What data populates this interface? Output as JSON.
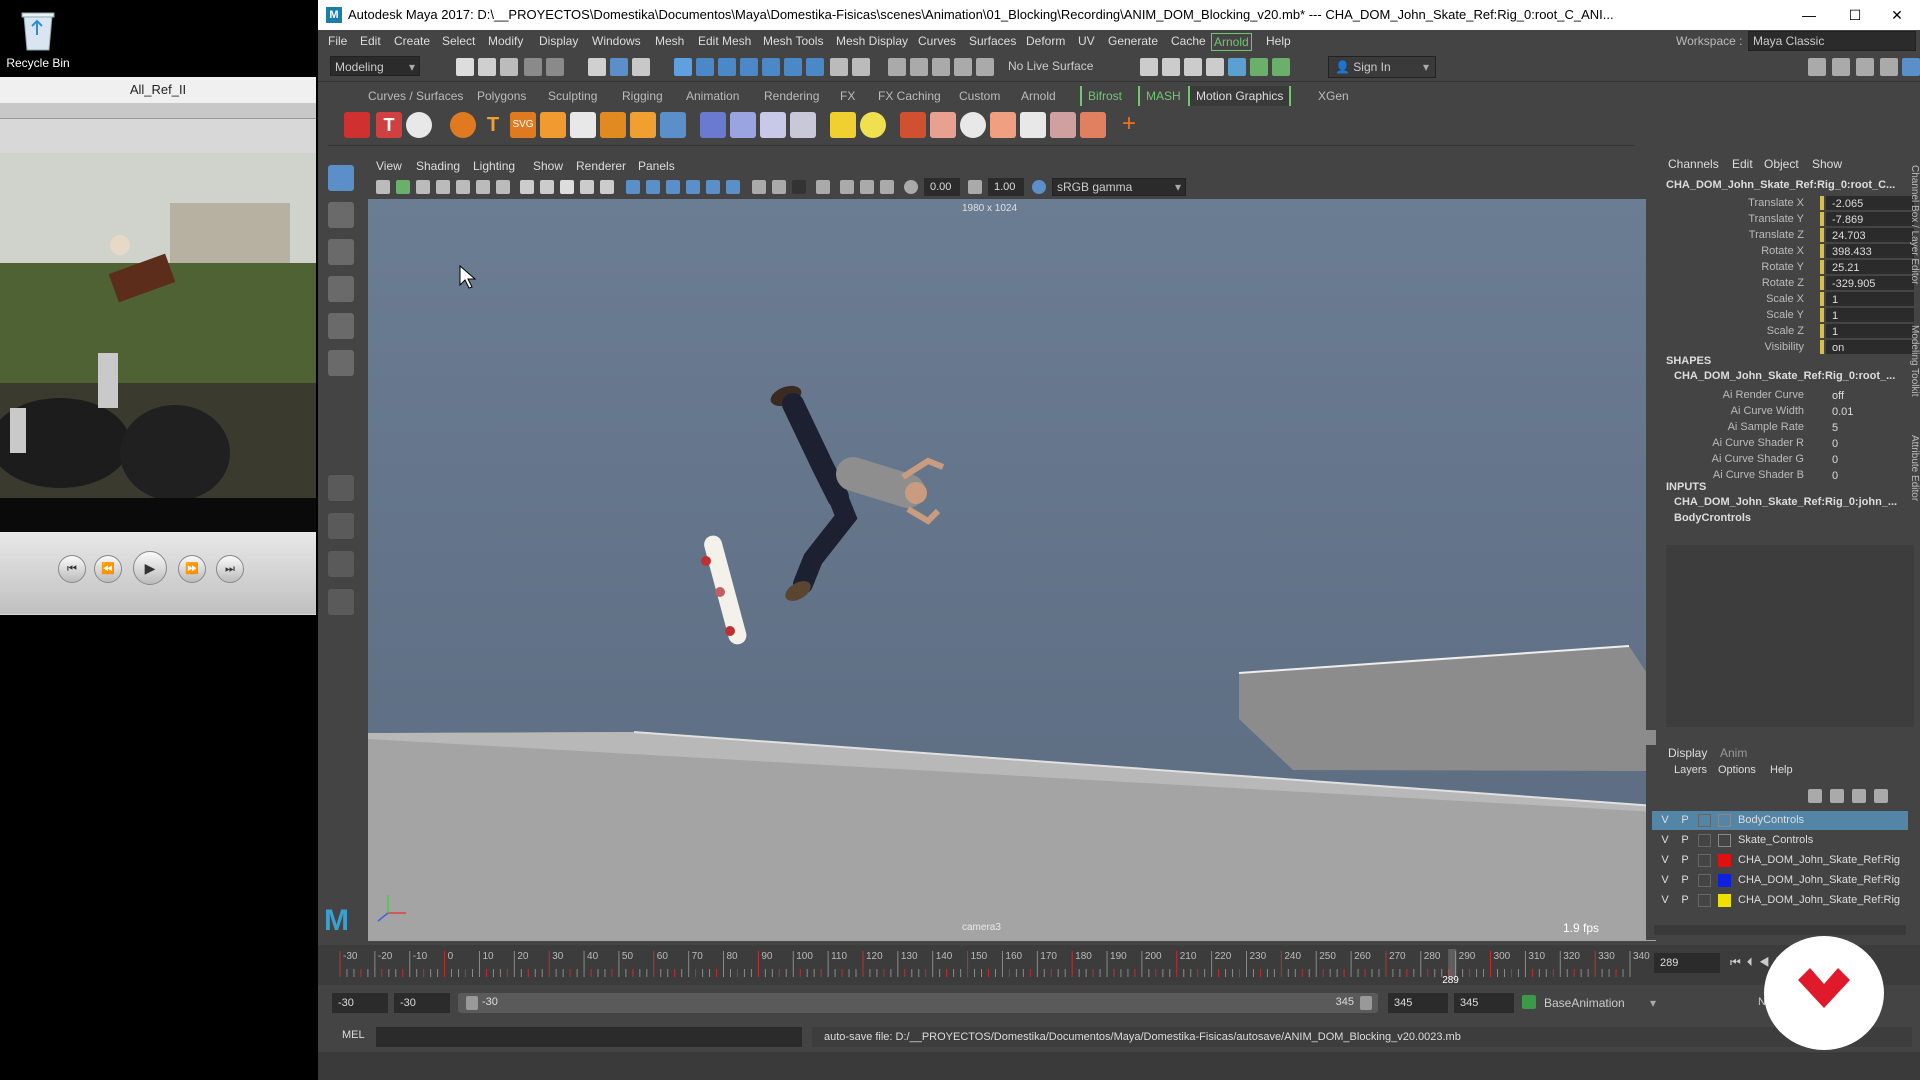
{
  "desktop": {
    "recycle_bin_label": "Recycle Bin",
    "player_title": "All_Ref_II"
  },
  "window": {
    "title": "Autodesk Maya 2017: D:\\__PROYECTOS\\Domestika\\Documentos\\Maya\\Domestika-Fisicas\\scenes\\Animation\\01_Blocking\\Recording\\ANIM_DOM_Blocking_v20.mb*   ---   CHA_DOM_John_Skate_Ref:Rig_0:root_C_ANI...",
    "logo": "M"
  },
  "menubar": {
    "items": [
      "File",
      "Edit",
      "Create",
      "Select",
      "Modify",
      "Display",
      "Windows",
      "Mesh",
      "Edit Mesh",
      "Mesh Tools",
      "Mesh Display",
      "Curves",
      "Surfaces",
      "Deform",
      "UV",
      "Generate",
      "Cache",
      "Arnold",
      "Help"
    ],
    "workspace_label": "Workspace :",
    "workspace_value": "Maya Classic"
  },
  "statusline": {
    "menuset": "Modeling",
    "live_surface": "No Live Surface",
    "sign_in": "Sign In"
  },
  "shelf_tabs": [
    "Curves / Surfaces",
    "Polygons",
    "Sculpting",
    "Rigging",
    "Animation",
    "Rendering",
    "FX",
    "FX Caching",
    "Custom",
    "Arnold",
    "Bifrost",
    "MASH",
    "Motion Graphics",
    "XGen"
  ],
  "viewport": {
    "menus": [
      "View",
      "Shading",
      "Lighting",
      "Show",
      "Renderer",
      "Panels"
    ],
    "field_a": "0.00",
    "field_b": "1.00",
    "color_space": "sRGB gamma",
    "resolution": "1980 x 1024",
    "camera": "camera3",
    "fps": "1.9 fps"
  },
  "channelbox": {
    "menus": [
      "Channels",
      "Edit",
      "Object",
      "Show"
    ],
    "node": "CHA_DOM_John_Skate_Ref:Rig_0:root_C...",
    "attrs": [
      {
        "label": "Translate X",
        "value": "-2.065"
      },
      {
        "label": "Translate Y",
        "value": "-7.869"
      },
      {
        "label": "Translate Z",
        "value": "24.703"
      },
      {
        "label": "Rotate X",
        "value": "398.433"
      },
      {
        "label": "Rotate Y",
        "value": "25.21"
      },
      {
        "label": "Rotate Z",
        "value": "-329.905"
      },
      {
        "label": "Scale X",
        "value": "1"
      },
      {
        "label": "Scale Y",
        "value": "1"
      },
      {
        "label": "Scale Z",
        "value": "1"
      },
      {
        "label": "Visibility",
        "value": "on"
      }
    ],
    "shapes_header": "SHAPES",
    "shape_node": "CHA_DOM_John_Skate_Ref:Rig_0:root_...",
    "shape_attrs": [
      {
        "label": "Ai Render Curve",
        "value": "off"
      },
      {
        "label": "Ai Curve Width",
        "value": "0.01"
      },
      {
        "label": "Ai Sample Rate",
        "value": "5"
      },
      {
        "label": "Ai Curve Shader R",
        "value": "0"
      },
      {
        "label": "Ai Curve Shader G",
        "value": "0"
      },
      {
        "label": "Ai Curve Shader B",
        "value": "0"
      }
    ],
    "inputs_header": "INPUTS",
    "input_nodes": [
      "CHA_DOM_John_Skate_Ref:Rig_0:john_...",
      "BodyCrontrols"
    ],
    "side_tabs": [
      "Channel Box / Layer Editor",
      "Modeling Toolkit",
      "Attribute Editor"
    ]
  },
  "layers": {
    "tabs": [
      "Display",
      "Anim"
    ],
    "menus": [
      "Layers",
      "Options",
      "Help"
    ],
    "rows": [
      {
        "v": "V",
        "p": "P",
        "name": "BodyControls",
        "color": "",
        "selected": true
      },
      {
        "v": "V",
        "p": "P",
        "name": "Skate_Controls",
        "color": "",
        "selected": false
      },
      {
        "v": "V",
        "p": "P",
        "name": "CHA_DOM_John_Skate_Ref:Rig",
        "color": "#e01010",
        "selected": false
      },
      {
        "v": "V",
        "p": "P",
        "name": "CHA_DOM_John_Skate_Ref:Rig",
        "color": "#1020e0",
        "selected": false
      },
      {
        "v": "V",
        "p": "P",
        "name": "CHA_DOM_John_Skate_Ref:Rig",
        "color": "#f0e000",
        "selected": false
      }
    ]
  },
  "timeline": {
    "ticks": [
      "-30",
      "-20",
      "-10",
      "0",
      "10",
      "20",
      "30",
      "40",
      "50",
      "60",
      "70",
      "80",
      "90",
      "100",
      "110",
      "120",
      "130",
      "140",
      "150",
      "160",
      "170",
      "180",
      "190",
      "200",
      "210",
      "220",
      "230",
      "240",
      "250",
      "260",
      "270",
      "280",
      "290",
      "300",
      "310",
      "320",
      "330",
      "340"
    ],
    "current_frame": "289",
    "current_field": "289"
  },
  "range": {
    "start_a": "-30",
    "start_b": "-30",
    "slider_start": "-30",
    "slider_end": "345",
    "end_a": "345",
    "end_b": "345",
    "anim_layer": "BaseAnimation",
    "extra": "N"
  },
  "cmdline": {
    "label": "MEL",
    "message": "auto-save file: D:/__PROYECTOS/Domestika/Documentos/Maya/Domestika-Fisicas/autosave/ANIM_DOM_Blocking_v20.0023.mb"
  }
}
